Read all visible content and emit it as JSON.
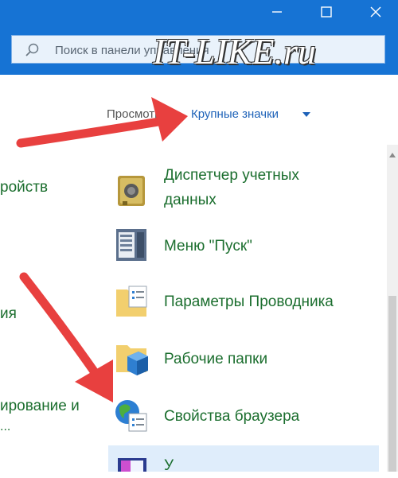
{
  "colors": {
    "titlebar": "#1673d4",
    "link_green": "#1b6e2e",
    "link_blue": "#1e62b8",
    "annotation_arrow": "#e8403f"
  },
  "window": {
    "minimize_icon": "minimize-icon",
    "maximize_icon": "maximize-icon",
    "close_icon": "close-icon"
  },
  "search": {
    "placeholder": "Поиск в панели управления",
    "icon": "search-icon"
  },
  "watermark": "IT-LIKE.ru",
  "view": {
    "label": "Просмотр:",
    "value": "Крупные значки"
  },
  "left_column": [
    "ройств",
    "ия",
    "ирование и",
    "..."
  ],
  "items": [
    {
      "label_line1": "Диспетчер учетных",
      "label_line2": "данных",
      "icon": "credential-manager-icon"
    },
    {
      "label": "Меню \"Пуск\"",
      "icon": "start-menu-icon"
    },
    {
      "label": "Параметры Проводника",
      "icon": "explorer-options-icon"
    },
    {
      "label": "Рабочие папки",
      "icon": "work-folders-icon"
    },
    {
      "label": "Свойства браузера",
      "icon": "browser-properties-icon"
    },
    {
      "label": "У",
      "icon": "next-item-icon"
    }
  ]
}
